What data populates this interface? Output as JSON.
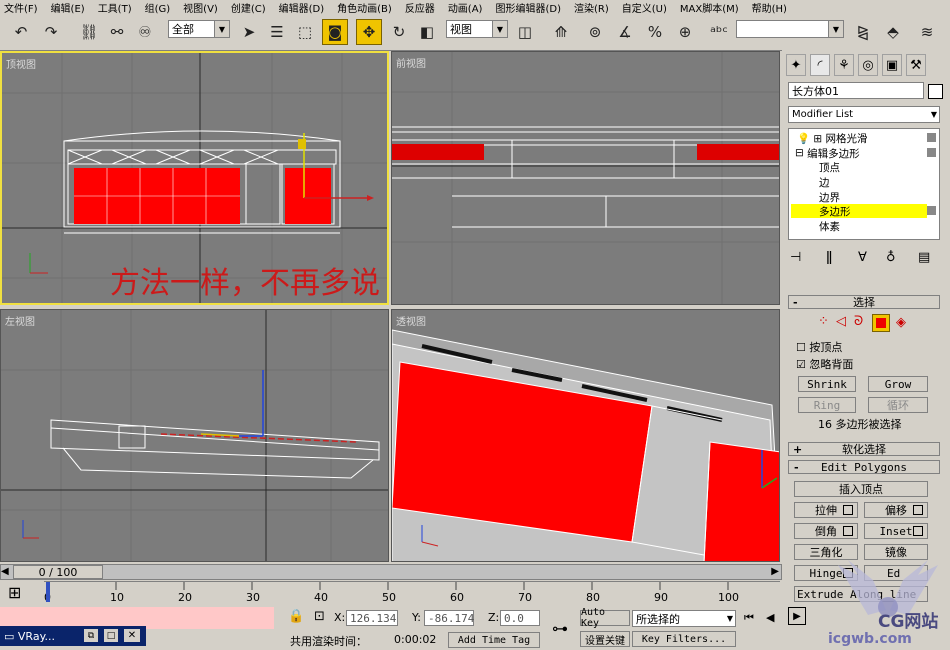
{
  "menu": [
    "文件(F)",
    "编辑(E)",
    "工具(T)",
    "组(G)",
    "视图(V)",
    "创建(C)",
    "编辑器(D)",
    "角色动画(B)",
    "反应器",
    "动画(A)",
    "图形编辑器(D)",
    "渲染(R)",
    "自定义(U)",
    "MAX脚本(M)",
    "帮助(H)"
  ],
  "toolbar": {
    "selection_filter": "全部",
    "ref_coord": "视图",
    "named_selection": ""
  },
  "viewports": {
    "top": "顶视图",
    "front": "前视图",
    "left": "左视图",
    "perspective": "透视图"
  },
  "overlay_caption": "方法一样，不再多说",
  "command_panel": {
    "object_name": "长方体01",
    "modifier_list": "Modifier List",
    "stack": [
      "网格光滑",
      "编辑多边形",
      "顶点",
      "边",
      "边界",
      "多边形",
      "体素"
    ],
    "selection": {
      "title": "选择",
      "by_vertex": "按顶点",
      "ignore_backfacing": "忽略背面",
      "shrink": "Shrink",
      "grow": "Grow",
      "ring": "Ring",
      "loop": "循环",
      "status": "16 多边形被选择"
    },
    "soft_selection": "软化选择",
    "edit_polygons": {
      "title": "Edit Polygons",
      "insert_vertex": "插入顶点",
      "extrude": "拉伸",
      "outline": "偏移",
      "bevel": "倒角",
      "inset": "Inset",
      "triangulate": "三角化",
      "mirror": "镜像",
      "hinge": "Hinge",
      "edit": "Ed",
      "extrude_along": "Extrude Along",
      "spline": "line"
    }
  },
  "timeline": {
    "counter": "0 / 100",
    "ticks": [
      "0",
      "10",
      "20",
      "30",
      "40",
      "50",
      "60",
      "70",
      "80",
      "90",
      "100"
    ]
  },
  "status": {
    "x_label": "X:",
    "x": "126.134",
    "y_label": "Y:",
    "y": "-86.174",
    "z_label": "Z:",
    "z": "0.0",
    "render_time_label": "共用渲染时间：",
    "render_time": "0:00:02",
    "add_time_tag": "Add Time Tag",
    "auto_key": "Auto Key",
    "set_key": "设置关键",
    "selected": "所选择的",
    "key_filters": "Key Filters...",
    "taskbar_item": "VRay...",
    "watermark_logo": "CG网站",
    "watermark_site": "icgwb.com"
  },
  "colors": {
    "viewport_bg": "#7c7c7c",
    "selected_poly": "#ff0000",
    "active_border": "#f0e040",
    "stack_highlight": "#ffff00"
  }
}
